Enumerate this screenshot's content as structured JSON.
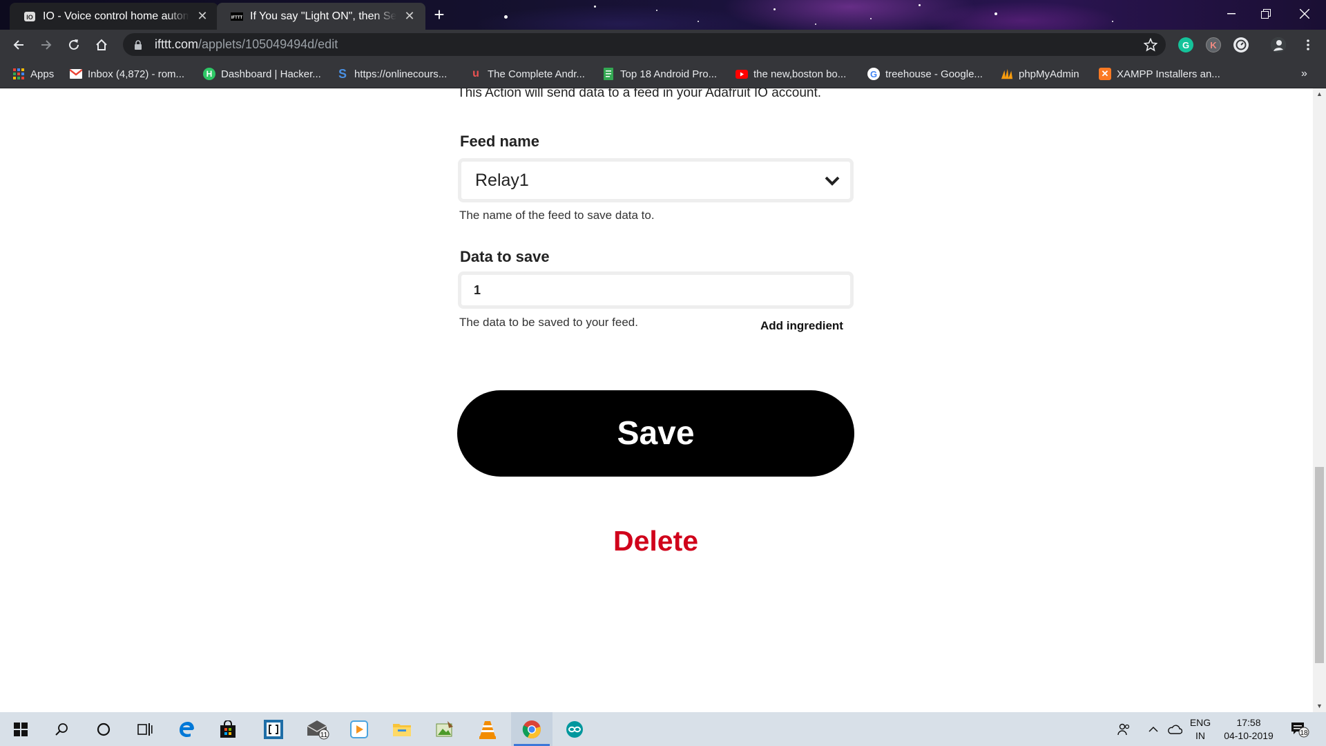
{
  "browser": {
    "tabs": [
      {
        "title": "IO - Voice control home automat",
        "favicon": "adafruit-io-icon",
        "active": false
      },
      {
        "title": "If You say \"Light ON\", then Send",
        "favicon": "ifttt-icon",
        "active": true
      }
    ],
    "url_domain": "ifttt.com",
    "url_path": "/applets/105049494d/edit",
    "bookmarks": [
      {
        "label": "Apps",
        "icon": "apps-grid-icon"
      },
      {
        "label": "Inbox (4,872) - rom...",
        "icon": "gmail-icon"
      },
      {
        "label": "Dashboard | Hacker...",
        "icon": "hackerrank-icon"
      },
      {
        "label": "https://onlinecours...",
        "icon": "s-icon"
      },
      {
        "label": "The Complete Andr...",
        "icon": "udemy-icon"
      },
      {
        "label": "Top 18 Android Pro...",
        "icon": "document-icon"
      },
      {
        "label": "the new,boston bo...",
        "icon": "youtube-icon"
      },
      {
        "label": "treehouse - Google...",
        "icon": "google-icon"
      },
      {
        "label": "phpMyAdmin",
        "icon": "phpmyadmin-icon"
      },
      {
        "label": "XAMPP Installers an...",
        "icon": "xampp-icon"
      }
    ]
  },
  "page": {
    "intro_text": "This Action will send data to a feed in your Adafruit IO account.",
    "feed_name_label": "Feed name",
    "feed_name_value": "Relay1",
    "feed_name_help": "The name of the feed to save data to.",
    "data_label": "Data to save",
    "data_value": "1",
    "data_help": "The data to be saved to your feed.",
    "add_ingredient_label": "Add ingredient",
    "save_label": "Save",
    "delete_label": "Delete",
    "colors": {
      "save_bg": "#000000",
      "delete": "#d0021b"
    }
  },
  "taskbar": {
    "mail_badge": "11",
    "language_line1": "ENG",
    "language_line2": "IN",
    "time": "17:58",
    "date": "04-10-2019",
    "notification_count": "18"
  }
}
